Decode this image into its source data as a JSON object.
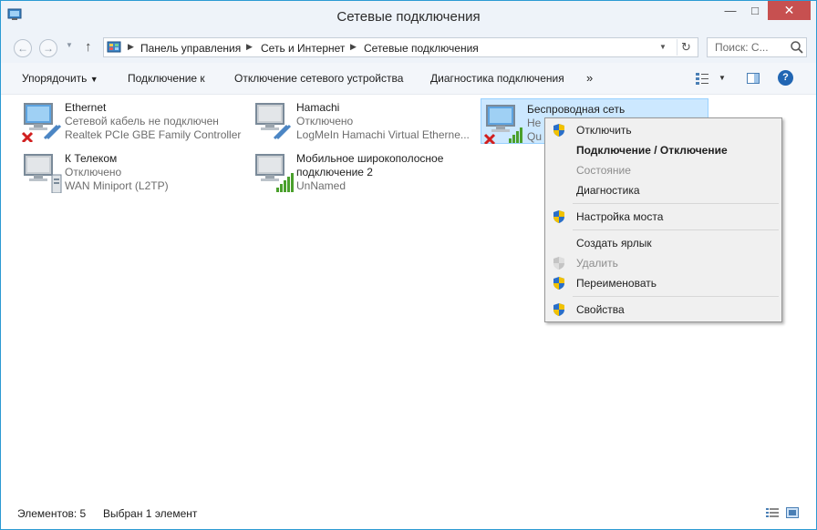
{
  "window": {
    "title": "Сетевые подключения",
    "buttons": {
      "minimize": "—",
      "maximize": "□",
      "close": "✕"
    }
  },
  "address": {
    "breadcrumbs": [
      "Панель управления",
      "Сеть и Интернет",
      "Сетевые подключения"
    ],
    "search_placeholder": "Поиск: С..."
  },
  "toolbar": {
    "organize": "Упорядочить",
    "connect": "Подключение к",
    "disable": "Отключение сетевого устройства",
    "diagnose": "Диагностика подключения",
    "more": "»",
    "help": "?"
  },
  "connections": [
    {
      "name": "Ethernet",
      "status": "Сетевой кабель не подключен",
      "device": "Realtek PCIe GBE Family Controller",
      "icon": "ethernet-disconnected-icon"
    },
    {
      "name": "Hamachi",
      "status": "Отключено",
      "device": "LogMeIn Hamachi Virtual Etherne...",
      "icon": "ethernet-icon"
    },
    {
      "name": "Беспроводная сеть",
      "status": "Не",
      "device": "Qu",
      "icon": "wireless-disconnected-icon",
      "selected": true
    },
    {
      "name": "К Телеком",
      "status": "Отключено",
      "device": "WAN Miniport (L2TP)",
      "icon": "wan-miniport-icon"
    },
    {
      "name_line1": "Мобильное широкополосное",
      "name_line2": "подключение 2",
      "device": "UnNamed",
      "icon": "mobile-broadband-icon"
    }
  ],
  "context_menu": {
    "items": [
      {
        "label": "Отключить",
        "shield": true
      },
      {
        "label": "Подключение / Отключение",
        "bold": true
      },
      {
        "label": "Состояние",
        "disabled": true
      },
      {
        "label": "Диагностика"
      },
      {
        "label": "Настройка моста",
        "shield": true
      },
      {
        "label": "Создать ярлык"
      },
      {
        "label": "Удалить",
        "shield": true,
        "disabled": true
      },
      {
        "label": "Переименовать",
        "shield": true
      },
      {
        "label": "Свойства",
        "shield": true
      }
    ]
  },
  "statusbar": {
    "count": "Элементов: 5",
    "selected": "Выбран 1 элемент"
  }
}
